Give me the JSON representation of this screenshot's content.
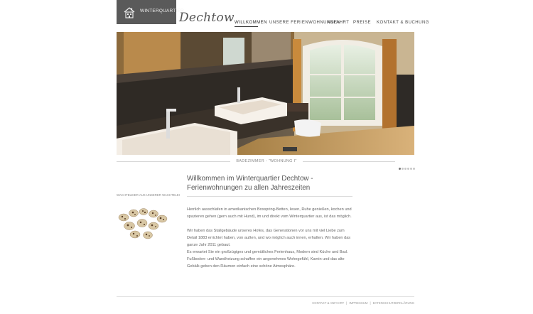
{
  "brand": {
    "logo_text": "WINTERQUARTIER",
    "script_name": "Dechtow"
  },
  "nav": {
    "items": [
      {
        "label": "WILLKOMMEN",
        "active": true
      },
      {
        "label": "UNSERE FERIENWOHNUNGEN"
      },
      {
        "label": "ANFAHRT"
      },
      {
        "label": "PREISE"
      },
      {
        "label": "KONTAKT & BUCHUNG"
      }
    ]
  },
  "hero": {
    "caption": "BADEZIMMER - \"WOHNUNG I\"",
    "slides_total": 6,
    "slide_active": 1
  },
  "main": {
    "title_line1": "Willkommen im Winterquartier Dechtow -",
    "title_line2": "Ferienwohnungen zu allen Jahreszeiten",
    "paragraphs": [
      "Herrlich ausschlafen in amerikanischen Boxspring-Betten, lesen, Ruhe genießen, kochen und spazieren gehen (gern auch mit Hund), im und direkt vom Winterquartier aus, ist das möglich.",
      "Wir haben das Stallgebäude unseres Hofes, das Generationen vor uns mit viel Liebe zum Detail 1883 errichtet haben, von außen, und wo möglich auch innen, erhalten. Wir haben das ganze Jahr 2011 gebaut.",
      "Es erwartet Sie ein großzügiges und gemütliches Ferienhaus, Modern sind Küche und Bad. Fußboden- und Wandheizung schaffen ein angenehmes Wohngefühl, Kamin und das alte Gebälk geben den Räumen einfach eine schöne Atmosphäre."
    ]
  },
  "side": {
    "caption": "WACHTELEIER AUS UNSERER WACHTELEI"
  },
  "footer": {
    "links": [
      "KONTAKT & ANFAHRT",
      "IMPRESSUM",
      "DATENSCHUTZERKLÄRUNG"
    ]
  },
  "colors": {
    "logo_bg": "#5a5a5a",
    "text": "#555555",
    "rule": "#dcdcdc"
  }
}
